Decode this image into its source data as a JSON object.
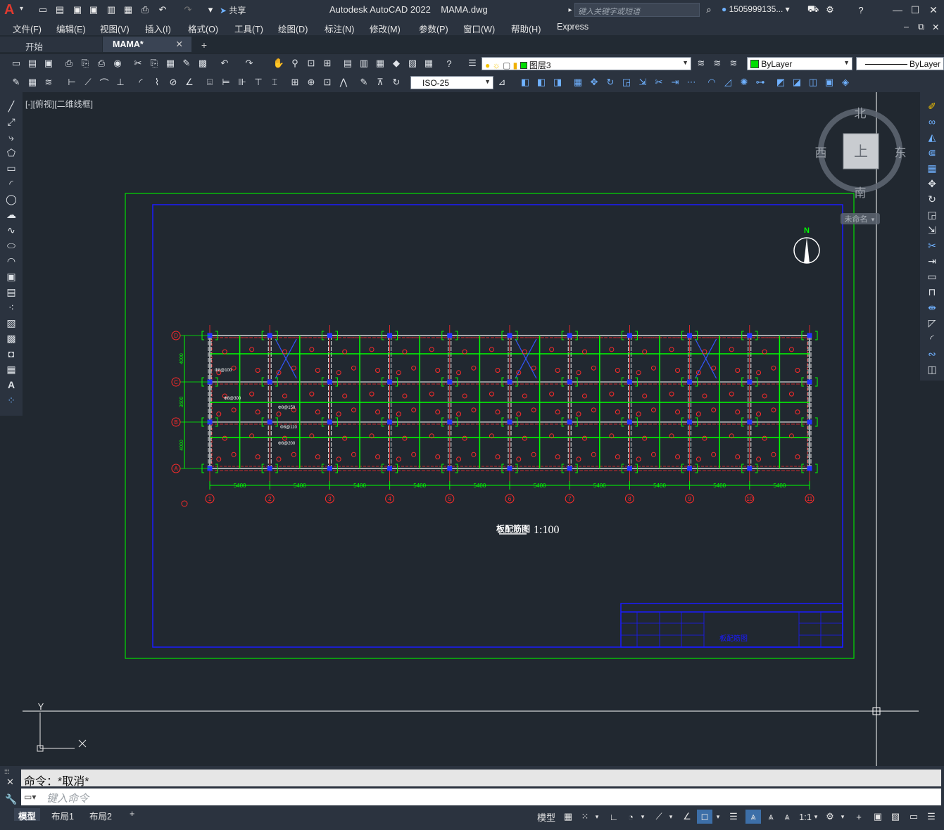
{
  "titlebar": {
    "logo": "A",
    "share_label": "共享",
    "app_title": "Autodesk AutoCAD 2022    MAMA.dwg",
    "search_placeholder": "键入关键字或短语",
    "user_name": "1505999135..."
  },
  "menubar": {
    "items": [
      "文件(F)",
      "编辑(E)",
      "视图(V)",
      "插入(I)",
      "格式(O)",
      "工具(T)",
      "绘图(D)",
      "标注(N)",
      "修改(M)",
      "参数(P)",
      "窗口(W)",
      "帮助(H)",
      "Express"
    ]
  },
  "tabs": {
    "start": "开始",
    "active": "MAMA*",
    "add": "+"
  },
  "toolbar": {
    "layer_name": "图层3",
    "color_name": "ByLayer",
    "linetype_name": "ByLayer",
    "dimstyle": "ISO-25"
  },
  "viewport": {
    "label": "[-][俯视][二维线框]",
    "viewcube": {
      "north": "北",
      "south": "南",
      "east": "东",
      "west": "西",
      "top": "上",
      "wcs": "未命名"
    },
    "ucs_y": "Y"
  },
  "drawing": {
    "title": "板配筋图",
    "scale": "1:100",
    "north_label": "N",
    "titleblock_text": "板配筋图",
    "column_dims": [
      "5400",
      "5400",
      "5400",
      "5400",
      "5400",
      "5400",
      "5400",
      "5400",
      "5400",
      "5400"
    ],
    "column_axes": [
      "1",
      "2",
      "3",
      "4",
      "5",
      "6",
      "7",
      "8",
      "9",
      "10",
      "11"
    ],
    "row_axes": [
      "D",
      "C",
      "B",
      "A"
    ],
    "row_dims": [
      "4000",
      "3600",
      "4000"
    ],
    "rebar_notes": [
      "Φ8@100",
      "Φ8@300",
      "Φ8@150",
      "Φ8@110",
      "Φ8@200"
    ],
    "colors": {
      "border_outer": "#00e000",
      "border_inner": "#1a1aff",
      "beam": "#00ff00",
      "wall": "#ffffff",
      "column": "#2233ff",
      "axis": "#ff2a2a",
      "rebar": "#ff2a2a"
    }
  },
  "command": {
    "history": "命令：*取消*",
    "placeholder": "键入命令"
  },
  "status": {
    "layout_tabs": [
      "模型",
      "布局1",
      "布局2"
    ],
    "model_label": "模型",
    "scale_label": "1:1"
  }
}
